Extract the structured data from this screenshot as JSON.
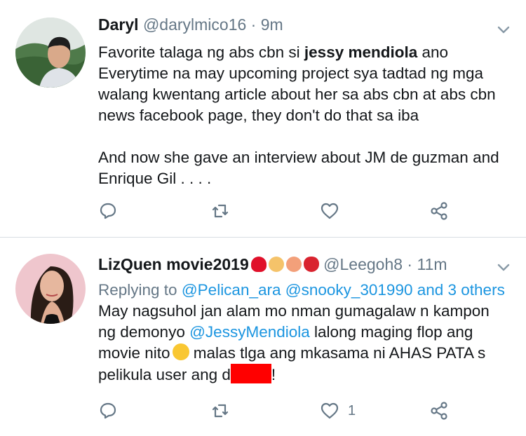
{
  "tweets": [
    {
      "name": "Daryl",
      "handle": "@darylmico16",
      "separator": " · ",
      "time": "9m",
      "body_lines": [
        {
          "pre": "Favorite talaga ng abs cbn si ",
          "bold": "jessy mendiola",
          "post": " ano"
        },
        {
          "text": "Everytime na may upcoming project sya tadtad ng mga"
        },
        {
          "text": "walang kwentang article about her sa abs cbn at abs cbn"
        },
        {
          "text": "news facebook page, they don't do that sa iba"
        },
        {
          "text": ""
        },
        {
          "text": "And now she gave an interview about JM de guzman and"
        },
        {
          "text": "Enrique Gil  . . . ."
        }
      ],
      "actions": {
        "reply_icon": "reply-icon",
        "retweet_icon": "retweet-icon",
        "like_icon": "like-icon",
        "like_count": "",
        "share_icon": "share-icon"
      }
    },
    {
      "name": "LizQuen movie2019",
      "name_emojis": [
        "red-heart-emoji",
        "angel-emoji",
        "bride-emoji",
        "strawberry-emoji"
      ],
      "handle": "@Leegoh8",
      "separator": " · ",
      "time": "11m",
      "replying_prefix": "Replying to ",
      "replying_to": "@Pelican_ara @snooky_301990 and 3 others",
      "line1": "May nagsuhol jan alam mo nman gumagalaw n kampon",
      "line2_pre": "ng demonyo ",
      "line2_mention": "@JessyMendiola",
      "line2_post": " lalong maging flop ang",
      "line3_pre": "movie nito",
      "line3_post": " malas tlga ang mkasama ni AHAS PATA s",
      "line4_pre": "pelikula user ang d",
      "line4_post": "!",
      "actions": {
        "reply_icon": "reply-icon",
        "retweet_icon": "retweet-icon",
        "like_icon": "like-icon",
        "like_count": "1",
        "share_icon": "share-icon"
      }
    }
  ],
  "colors": {
    "link": "#1b95e0",
    "muted": "#657786",
    "text": "#14171a",
    "redaction": "#ff0000"
  }
}
